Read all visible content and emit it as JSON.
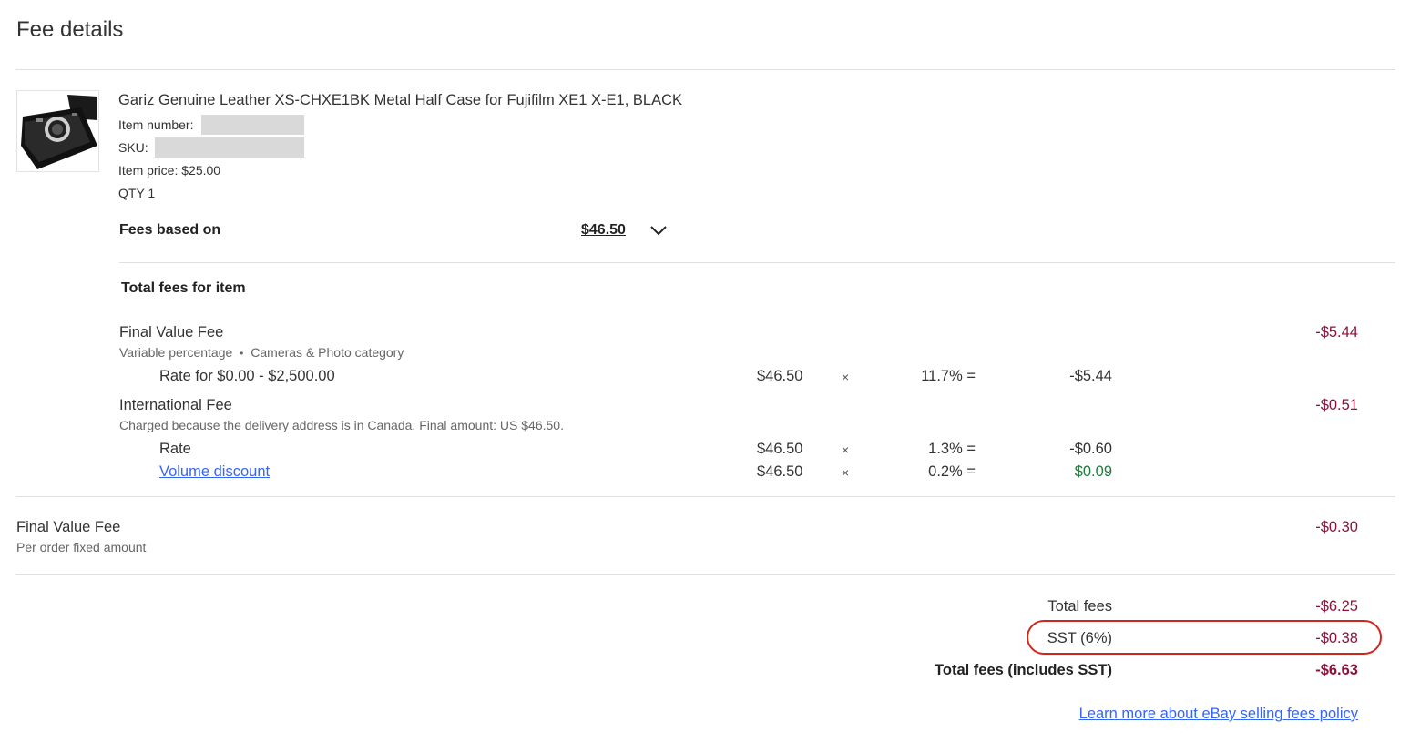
{
  "page_title": "Fee details",
  "item": {
    "title": "Gariz Genuine Leather XS-CHXE1BK Metal Half Case for Fujifilm XE1 X-E1, BLACK",
    "item_number_label": "Item number:",
    "sku_label": "SKU:",
    "price_text": "Item price: $25.00",
    "qty_text": "QTY 1"
  },
  "fees_based_on": {
    "label": "Fees based on",
    "amount": "$46.50"
  },
  "total_fees_for_item_label": "Total fees for item",
  "final_value_fee": {
    "name": "Final Value Fee",
    "sub_a": "Variable percentage",
    "sub_sep": "•",
    "sub_b": "Cameras & Photo category",
    "total": "-$5.44",
    "rate_label": "Rate for $0.00 - $2,500.00",
    "rate_base": "$46.50",
    "rate_x": "×",
    "rate_pct": "11.7% =",
    "rate_result": "-$5.44"
  },
  "international_fee": {
    "name": "International Fee",
    "sub": "Charged because the delivery address is in Canada. Final amount: US $46.50.",
    "total": "-$0.51",
    "rate_label": "Rate",
    "rate_base": "$46.50",
    "rate_x": "×",
    "rate_pct": "1.3% =",
    "rate_result": "-$0.60",
    "discount_label": "Volume discount",
    "discount_base": "$46.50",
    "discount_x": "×",
    "discount_pct": "0.2% =",
    "discount_result": "$0.09"
  },
  "order_fee": {
    "name": "Final Value Fee",
    "sub": "Per order fixed amount",
    "total": "-$0.30"
  },
  "summary": {
    "total_fees_label": "Total fees",
    "total_fees_value": "-$6.25",
    "sst_label": "SST (6%)",
    "sst_value": "-$0.38",
    "grand_label": "Total fees (includes SST)",
    "grand_value": "-$6.63"
  },
  "learn_more": "Learn more about eBay selling fees policy",
  "colors": {
    "negative": "#8a1538",
    "positive": "#1e7b3c",
    "link": "#3665f3",
    "highlight": "#d0271d"
  }
}
